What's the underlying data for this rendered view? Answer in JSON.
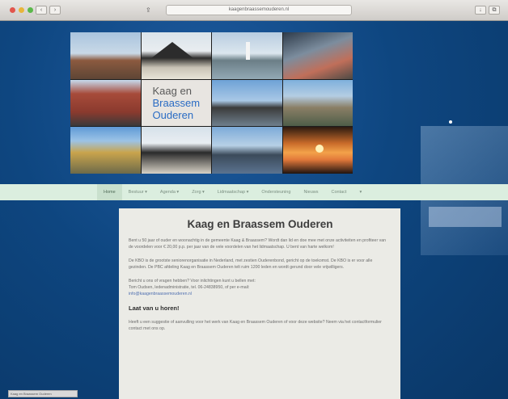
{
  "browser": {
    "address": "kaagenbraassemouderen.nl",
    "nav_back": "‹",
    "nav_forward": "›"
  },
  "header": {
    "logo_line1": "Kaag en",
    "logo_line2": "Braassem",
    "logo_line3": "Ouderen",
    "photo_alt": [
      "dorp",
      "huis",
      "zeilboot",
      "dorpsstraat",
      "huizen",
      "",
      "brug",
      "boom",
      "huizen aan water",
      "huis",
      "boot",
      "zonsondergang"
    ]
  },
  "menu": {
    "items": [
      "Home",
      "Bestuur ▾",
      "Agenda ▾",
      "Zorg ▾",
      "Lidmaatschap ▾",
      "Ondersteuning",
      "Nieuws",
      "Contact",
      "▾"
    ]
  },
  "content": {
    "title": "Kaag en Braassem Ouderen",
    "paragraph1": "Bent u 50 jaar of ouder en woonachtig in de gemeente Kaag & Braassem? Wordt dan lid en doe mee met onze activiteiten en profiteer van de voordelen voor € 20,00 p.p. per jaar van de vele voordelen van het lidmaatschap. U bent van harte welkom!",
    "paragraph2": "De KBO is de grootste seniorenorganisatie in Nederland, met zestien Ouderenbond, gericht op de toekomst. De KBO is er voor alle gezinden. De PBC afdeling Kaag en Braassem Ouderen telt ruim 1200 leden en wordt gerund door vele vrijwilligers.",
    "paragraph3_line1": "Bericht u ons of vragen hebben? Voor inlichtingen kunt u bellen met:",
    "paragraph3_line2": "Tom Oudsen, ledenadministratie, tel. 06-24838950, of per e-mail:",
    "paragraph3_email": "info@kaagenbraassemouderen.nl",
    "subheading": "Laat van u horen!",
    "paragraph4": "Heeft u een suggestie of aanvulling voor het werk van Kaag en Braassem Ouderen of voor deze website? Neem via het contactformulier contact met ons op."
  },
  "status": {
    "text": "Kaag en Braassem Ouderen"
  },
  "colors": {
    "background": "#0e4680",
    "menu_bar": "#dbeedf",
    "card": "#ebebe6",
    "logo_accent": "#2a6cc4"
  }
}
